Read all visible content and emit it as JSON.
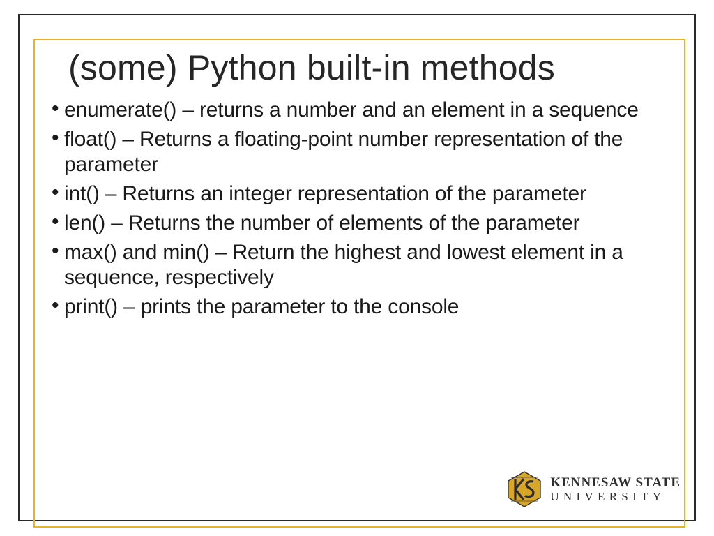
{
  "slide": {
    "title": "(some) Python built-in methods",
    "bullets": [
      "enumerate() – returns a number and an element in a sequence",
      "float() – Returns a floating-point number representation of the parameter",
      "int() – Returns an integer representation of the parameter",
      "len() – Returns the number of elements of the parameter",
      "max() and min() – Return the highest and lowest element in a sequence, respectively",
      "print() – prints the parameter to the console"
    ]
  },
  "logo": {
    "line1": "KENNESAW STATE",
    "line2": "UNIVERSITY"
  },
  "colors": {
    "outer_border": "#2a2a2a",
    "inner_border": "#eab41f",
    "text": "#1a1a1a",
    "logo_gold": "#d9a728"
  }
}
